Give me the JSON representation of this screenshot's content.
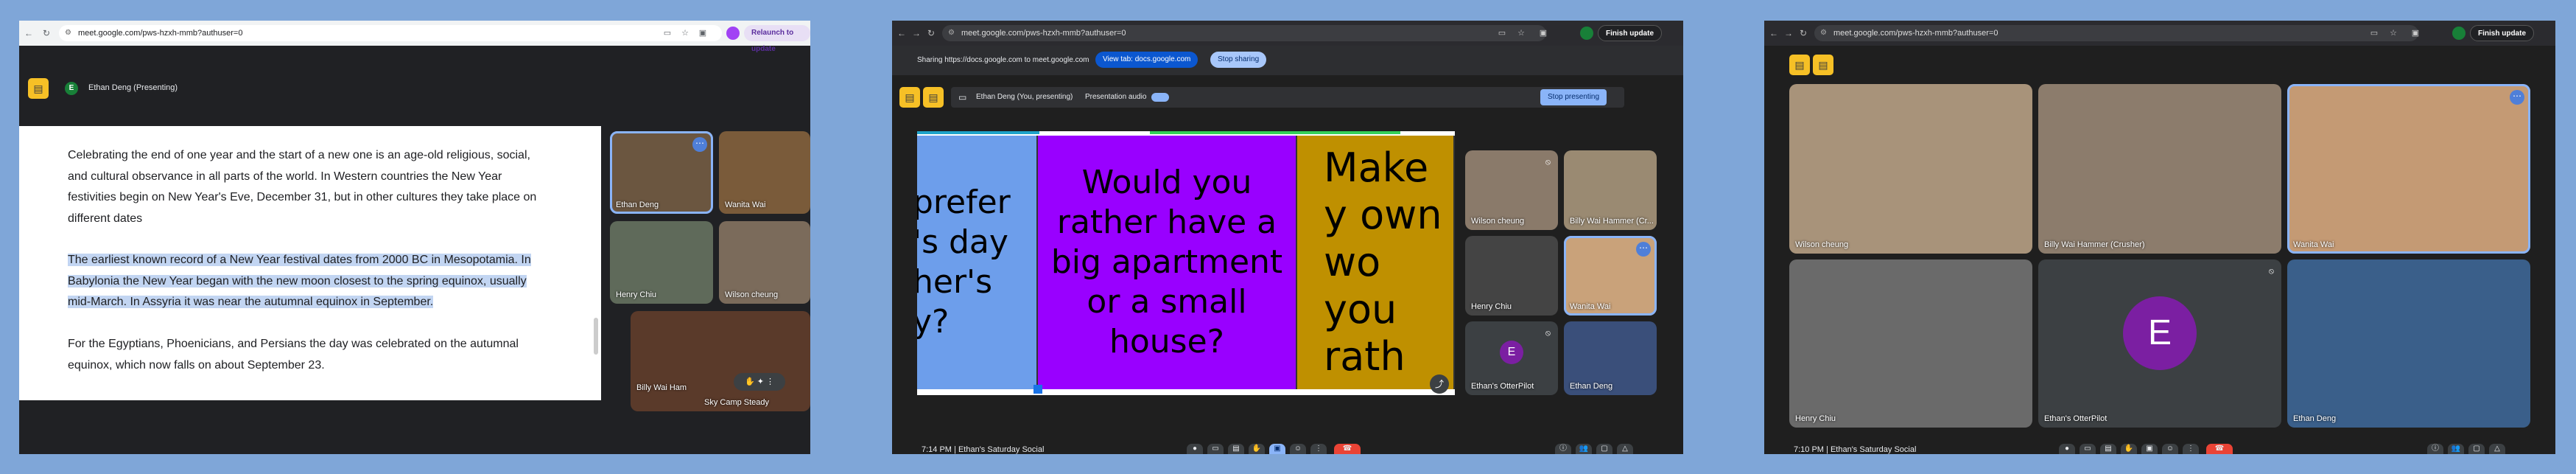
{
  "panel1": {
    "url": "meet.google.com/pws-hzxh-mmb?authuser=0",
    "relaunch_label": "Relaunch to update",
    "presenter_label": "Ethan Deng (Presenting)",
    "avatar_letter": "E",
    "doc_paragraphs": [
      "Celebrating the end of one year and the start of a new one is an age-old religious, social, and cultural observance in all parts of the world. In Western countries the New Year festivities begin on New Year's Eve, December 31, but in other cultures they take place on different dates",
      "The earliest known record of a New Year festival dates from 2000 BC in Mesopotamia. In Babylonia the New Year began with the new moon closest to the spring equinox, usually mid-March. In Assyria it was near the autumnal equinox in September.",
      "For the Egyptians, Phoenicians, and Persians the day was celebrated on the autumnal equinox, which now falls on about September 23."
    ],
    "tiles": [
      {
        "name": "Ethan Deng"
      },
      {
        "name": "Wanita Wai"
      },
      {
        "name": "Henry Chiu"
      },
      {
        "name": "Wilson cheung"
      },
      {
        "name": "Billy Wai Ham"
      },
      {
        "name": "Sky Camp Steady"
      }
    ]
  },
  "panel2": {
    "url": "meet.google.com/pws-hzxh-mmb?authuser=0",
    "finish_update": "Finish update",
    "sharing_text": "Sharing https://docs.google.com to meet.google.com",
    "view_tab": "View tab: docs.google.com",
    "stop_sharing": "Stop sharing",
    "presenter_label": "Ethan Deng (You, presenting)",
    "presentation_audio": "Presentation audio",
    "stop_presenting": "Stop presenting",
    "slides": [
      {
        "text": "prefer 's day her's y?",
        "color": "#6d9eeb"
      },
      {
        "text": "Would you rather have a big apartment or a small house?",
        "color": "#9900ff"
      },
      {
        "text": "Make y own wo you rath",
        "color": "#bf9000"
      }
    ],
    "tiles": [
      {
        "name": "Wilson cheung"
      },
      {
        "name": "Billy Wai Hammer (Cr..."
      },
      {
        "name": "Henry Chiu"
      },
      {
        "name": "Wanita Wai"
      },
      {
        "name": "Ethan's OtterPilot",
        "letter": "E"
      },
      {
        "name": "Ethan Deng"
      }
    ],
    "time": "7:14 PM",
    "meeting": "Ethan's Saturday Social"
  },
  "panel3": {
    "url": "meet.google.com/pws-hzxh-mmb?authuser=0",
    "finish_update": "Finish update",
    "tiles": [
      {
        "name": "Wilson cheung"
      },
      {
        "name": "Billy Wai Hammer (Crusher)"
      },
      {
        "name": "Wanita Wai"
      },
      {
        "name": "Henry Chiu"
      },
      {
        "name": "Ethan's OtterPilot",
        "letter": "E"
      },
      {
        "name": "Ethan Deng"
      }
    ],
    "time": "7:10 PM",
    "meeting": "Ethan's Saturday Social"
  },
  "colors": {
    "accent_blue": "#8ab4f8",
    "meet_yellow": "#f6c026",
    "end_red": "#ea4335",
    "otter_purple": "#7b1fa2"
  },
  "icons": [
    "back-arrow-icon",
    "forward-arrow-icon",
    "reload-icon",
    "tune-icon",
    "star-icon",
    "extension-icon",
    "more-vert-icon",
    "present-icon",
    "mic-icon",
    "camera-icon",
    "hand-icon",
    "call-end-icon",
    "info-icon",
    "people-icon",
    "chat-icon",
    "activities-icon"
  ]
}
